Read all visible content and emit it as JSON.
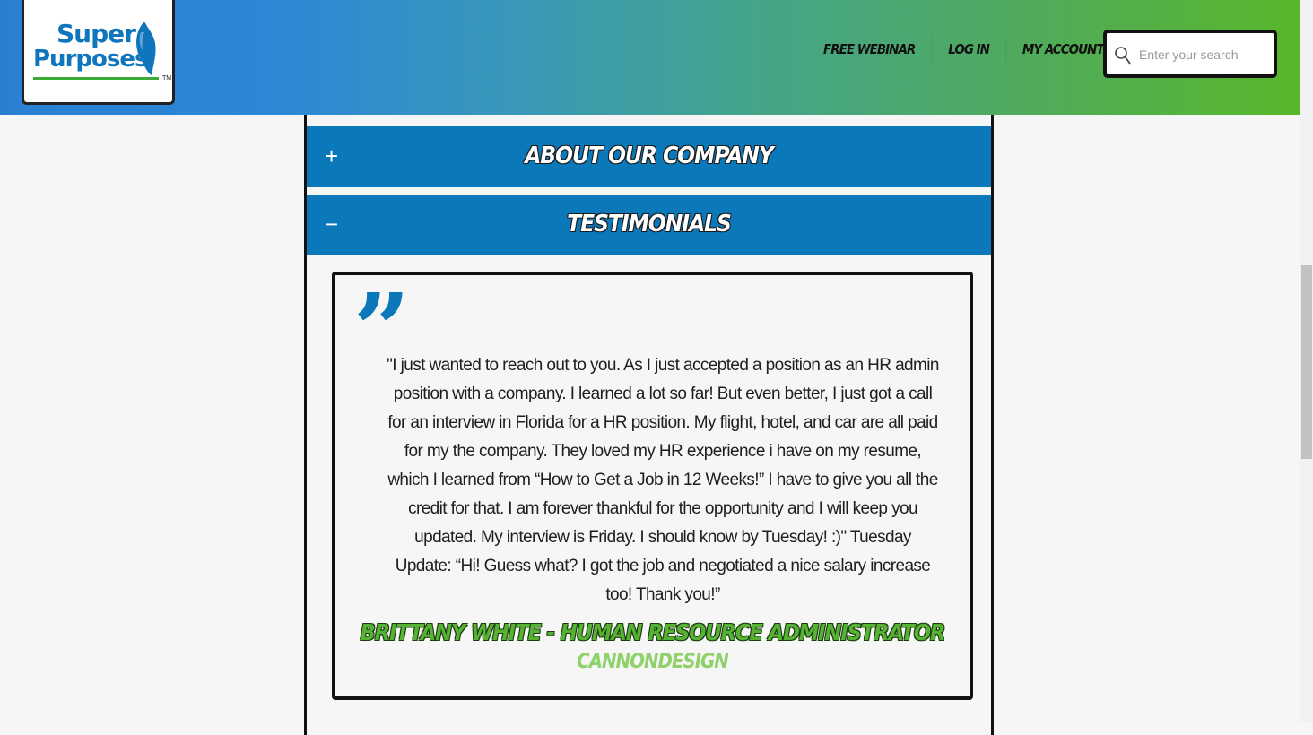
{
  "header": {
    "logo": {
      "line1": "Super",
      "line2": "Purposes",
      "tm": "TM"
    },
    "nav": [
      "FREE WEBINAR",
      "LOG IN",
      "MY ACCOUNT"
    ],
    "search": {
      "placeholder": "Enter your search",
      "icon": "search-icon"
    }
  },
  "accordion": [
    {
      "sign": "+",
      "title": "ABOUT OUR COMPANY",
      "expanded": false
    },
    {
      "sign": "−",
      "title": "TESTIMONIALS",
      "expanded": true
    }
  ],
  "testimonial": {
    "quote_glyph": "”",
    "text": "\"I just wanted to reach out to you. As I just accepted a position as an HR admin position with a company. I learned a lot so far! But even better, I just got a call for an interview in Florida for a HR position. My flight, hotel, and car are all paid for my the company. They loved my HR experience i have on my resume, which I learned from “How to Get a Job in 12 Weeks!” I have to give you all the credit for that. I am forever thankful for the opportunity and I will keep you updated. My interview is Friday. I should know by Tuesday! :)\" Tuesday Update: “Hi! Guess what? I got the job and negotiated a nice salary increase too! Thank you!”",
    "author": "BRITTANY WHITE - HUMAN RESOURCE ADMINISTRATOR",
    "company": "CANNONDESIGN"
  },
  "colors": {
    "accordion_bg": "#0b79b9",
    "author_green": "#56b233",
    "company_green": "#8fd26b",
    "logo_blue": "#0f76bd"
  }
}
